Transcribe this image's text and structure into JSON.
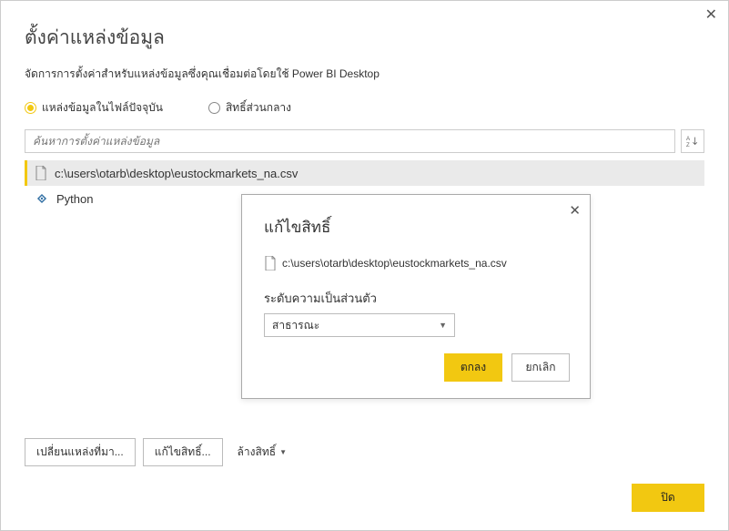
{
  "title": "ตั้งค่าแหล่งข้อมูล",
  "subtitle": "จัดการการตั้งค่าสำหรับแหล่งข้อมูลซึ่งคุณเชื่อมต่อโดยใช้ Power BI Desktop",
  "radio": {
    "current_file": "แหล่งข้อมูลในไฟล์ปัจจุบัน",
    "global": "สิทธิ์ส่วนกลาง"
  },
  "search": {
    "placeholder": "ค้นหาการตั้งค่าแหล่งข้อมูล",
    "sort_label": "A↓Z"
  },
  "list": {
    "items": [
      {
        "label": "c:\\users\\otarb\\desktop\\eustockmarkets_na.csv",
        "type": "file"
      },
      {
        "label": "Python",
        "type": "python"
      }
    ]
  },
  "bottom_buttons": {
    "change_source": "เปลี่ยนแหล่งที่มา...",
    "edit_permissions": "แก้ไขสิทธิ์...",
    "clear_permissions": "ล้างสิทธิ์"
  },
  "close_label": "ปิด",
  "inner": {
    "title": "แก้ไขสิทธิ์",
    "path": "c:\\users\\otarb\\desktop\\eustockmarkets_na.csv",
    "privacy_label": "ระดับความเป็นส่วนตัว",
    "privacy_value": "สาธารณะ",
    "ok": "ตกลง",
    "cancel": "ยกเลิก"
  }
}
